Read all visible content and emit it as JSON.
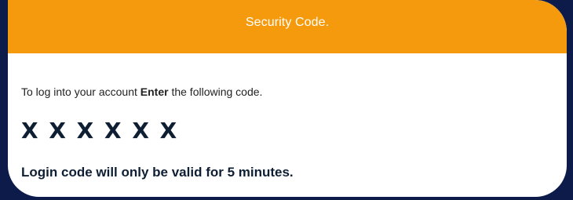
{
  "header": {
    "title": "Security Code."
  },
  "content": {
    "instruction_prefix": "To log into your account ",
    "instruction_bold": "Enter",
    "instruction_suffix": " the following code.",
    "code": "X X X X X X",
    "validity_text": "Login code will only be valid for 5 minutes."
  },
  "colors": {
    "frame_background": "#0d1b4b",
    "header_background": "#f59a0c",
    "card_background": "#ffffff",
    "code_text": "#0f1f33"
  }
}
